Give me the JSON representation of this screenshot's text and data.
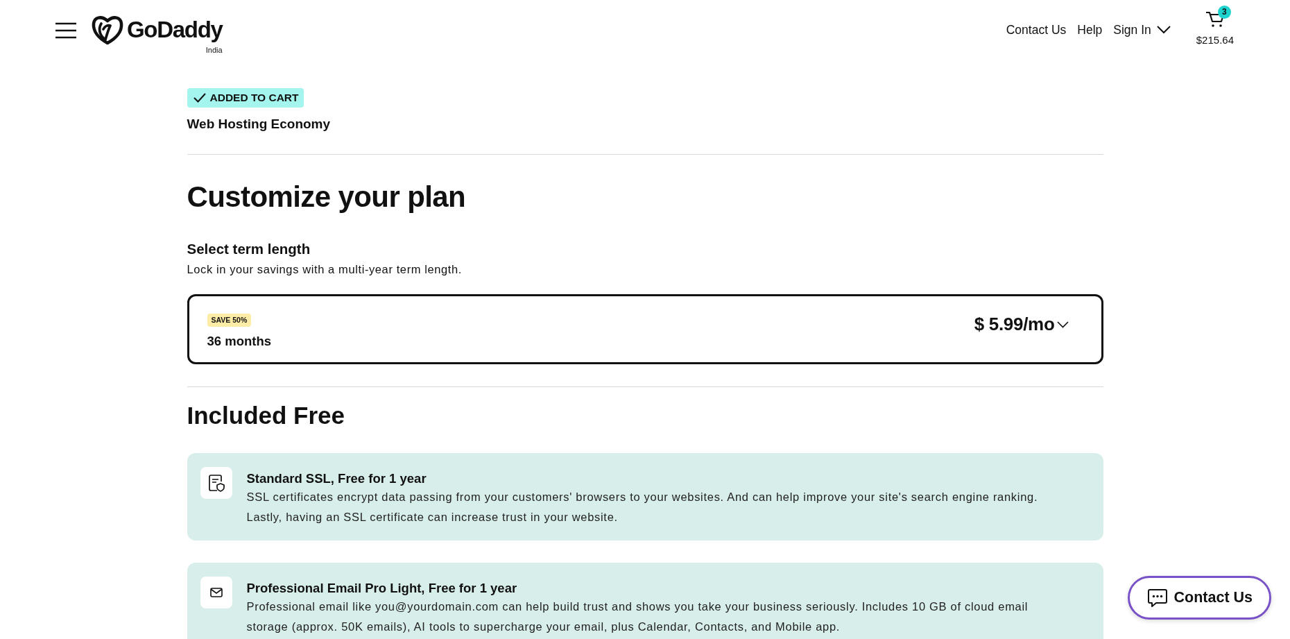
{
  "header": {
    "logo": {
      "wordmark": "GoDaddy",
      "region": "India"
    },
    "nav_links": [
      "Contact Us",
      "Help"
    ],
    "sign_in": "Sign In",
    "cart": {
      "count": "3",
      "total": "$215.64"
    }
  },
  "cart_notice": {
    "badge": "ADDED TO CART",
    "product": "Web Hosting Economy"
  },
  "customize": {
    "title": "Customize your plan",
    "term": {
      "label": "Select term length",
      "hint": "Lock in your savings with a multi-year term length.",
      "selector": {
        "tag": "SAVE 50%",
        "term": "36 months",
        "price": "$ 5.99/mo"
      }
    }
  },
  "included": {
    "title": "Included Free",
    "items": [
      {
        "kind": "ssl",
        "title": "Standard SSL, Free for 1 year",
        "description": "SSL certificates encrypt data passing from your customers' browsers to your websites. And can help improve your site's search engine ranking. Lastly, having an SSL certificate can increase trust in your website."
      },
      {
        "kind": "email",
        "title": "Professional Email Pro Light, Free for 1 year",
        "description": "Professional email like you@yourdomain.com can help build trust and shows you take your business seriously. Includes 10 GB of cloud email storage (approx. 50K emails), AI tools to supercharge your email, plus Calendar, Contacts, and Mobile app."
      }
    ]
  },
  "chat_button": {
    "label": "Contact Us"
  }
}
